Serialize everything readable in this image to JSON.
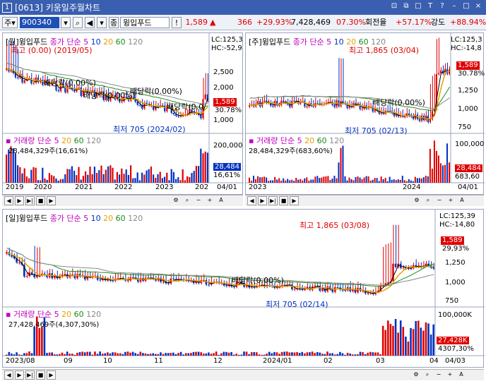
{
  "window": {
    "number": "1",
    "title": "[0613] 키움일주월차트",
    "controls": [
      "⊡",
      "⧉",
      "□",
      "T",
      "?",
      "–",
      "□",
      "×"
    ]
  },
  "toolbar": {
    "market": "주",
    "code": "900340",
    "name": "윙입푸드",
    "price": "1,589",
    "change": "366",
    "change_rate": "+29.93%",
    "volume": "7,428,469",
    "turnover_pct": "07.30%",
    "turnover_label": "회전율",
    "turnover_value": "+57.17%",
    "strength_label": "강도",
    "strength_value": "+88.94%"
  },
  "panel_weekly": {
    "title_prefix": "[월]윙입푸드",
    "ma_label": "종가 단순",
    "ma_periods": [
      "5",
      "10",
      "20",
      "60",
      "120"
    ],
    "lc": "LC:125,3",
    "hc": "HC:-52,9",
    "high_label": "최고 (0.00) (2019/05)",
    "low_label": "최저 705 (2024/02)",
    "dividends": [
      "배당락(0.00%)",
      "배당락(0.00%)",
      "배당락(0.00%)",
      "배당락(0.0"
    ],
    "y_ticks": [
      "3,000",
      "2,500",
      "2,000",
      "1,500",
      "1,000"
    ],
    "price_tag": "1,589",
    "pct_tag": "30.78%",
    "vol_title": "거래량",
    "vol_ma_label": "단순",
    "vol_ma_periods": [
      "5",
      "20",
      "60",
      "120"
    ],
    "vol_text": "28,484,329주(16,61%)",
    "vol_tick": "200,000",
    "vol_tag": "28,484",
    "vol_tag2": "16,61%",
    "x_ticks": [
      "2019",
      "2020",
      "2021",
      "2022",
      "2023",
      "202",
      "04/01"
    ]
  },
  "panel_monthly": {
    "title_prefix": "[주]윙입푸드",
    "ma_label": "종가 단순",
    "ma_periods": [
      "5",
      "10",
      "20",
      "60",
      "120"
    ],
    "lc": "LC:125,3",
    "hc": "HC:-14,8",
    "high_label": "최고 1,865 (03/04)",
    "low_label": "최저 705 (02/13)",
    "dividend": "배당락(0.00%)",
    "y_ticks": [
      "1,250",
      "1,000",
      "750"
    ],
    "price_tag": "1,589",
    "pct_tag": "30.78%",
    "vol_title": "거래량",
    "vol_ma_label": "단순",
    "vol_ma_periods": [
      "5",
      "20",
      "60",
      "120"
    ],
    "vol_text": "28,484,329주(683,60%)",
    "vol_tick": "100,000",
    "vol_tag": "28,484",
    "vol_tag2": "683,60",
    "x_ticks": [
      "2023",
      "2024",
      "04/01"
    ]
  },
  "panel_daily": {
    "title_prefix": "[일]윙입푸드",
    "ma_label": "종가 단순",
    "ma_periods": [
      "5",
      "10",
      "20",
      "60",
      "120"
    ],
    "lc": "LC:125,39",
    "hc": "HC:-14,80",
    "high_label": "최고 1,865 (03/08)",
    "low_label": "최저 705 (02/14)",
    "dividend": "배당락(0.00%)",
    "y_ticks": [
      "1,250",
      "1,000",
      "750"
    ],
    "price_tag": "1,589",
    "pct_tag": "29,93%",
    "vol_title": "거래량",
    "vol_ma_label": "단순",
    "vol_ma_periods": [
      "5",
      "20",
      "60",
      "120"
    ],
    "vol_text": "27,428,469주(4,307,30%)",
    "vol_tick": "100,000K",
    "vol_tag": "27,428K",
    "vol_tag2": "4307,30%",
    "x_ticks": [
      "2023/08",
      "09",
      "10",
      "11",
      "12",
      "2024/01",
      "02",
      "03",
      "04",
      "04/03"
    ]
  },
  "nav_buttons": [
    "◀",
    "▶",
    "▶|",
    "■",
    "▶"
  ],
  "colors": {
    "up": "#e00000",
    "down": "#0030c0",
    "ma5": "#000000",
    "ma20": "#e8a000",
    "ma60": "#1a8a1a",
    "ma120": "#888888"
  }
}
